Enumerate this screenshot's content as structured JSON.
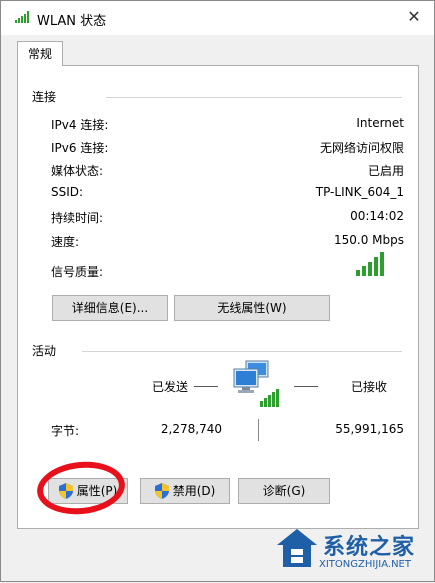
{
  "window": {
    "title": "WLAN 状态",
    "close_glyph": "✕"
  },
  "tabs": [
    {
      "label": "常规"
    }
  ],
  "connection": {
    "section_label": "连接",
    "rows": [
      {
        "label": "IPv4 连接:",
        "value": "Internet"
      },
      {
        "label": "IPv6 连接:",
        "value": "无网络访问权限"
      },
      {
        "label": "媒体状态:",
        "value": "已启用"
      },
      {
        "label": "SSID:",
        "value": "TP-LINK_604_1"
      },
      {
        "label": "持续时间:",
        "value": "00:14:02"
      },
      {
        "label": "速度:",
        "value": "150.0 Mbps"
      },
      {
        "label": "信号质量:",
        "value": ""
      }
    ],
    "signal_bars": 5,
    "details_button": "详细信息(E)...",
    "wireless_props_button": "无线属性(W)"
  },
  "activity": {
    "section_label": "活动",
    "sent_label": "已发送",
    "received_label": "已接收",
    "bytes_label": "字节:",
    "bytes_sent": "2,278,740",
    "bytes_received": "55,991,165"
  },
  "buttons": {
    "properties": "属性(P)",
    "disable": "禁用(D)",
    "diagnose": "诊断(G)"
  },
  "watermark": {
    "text": "系统之家",
    "url": "XITONGZHIJIA.NET"
  },
  "colors": {
    "signal": "#2e9e2e",
    "annotation_circle": "#e8101a",
    "watermark": "#1f5fa8"
  }
}
